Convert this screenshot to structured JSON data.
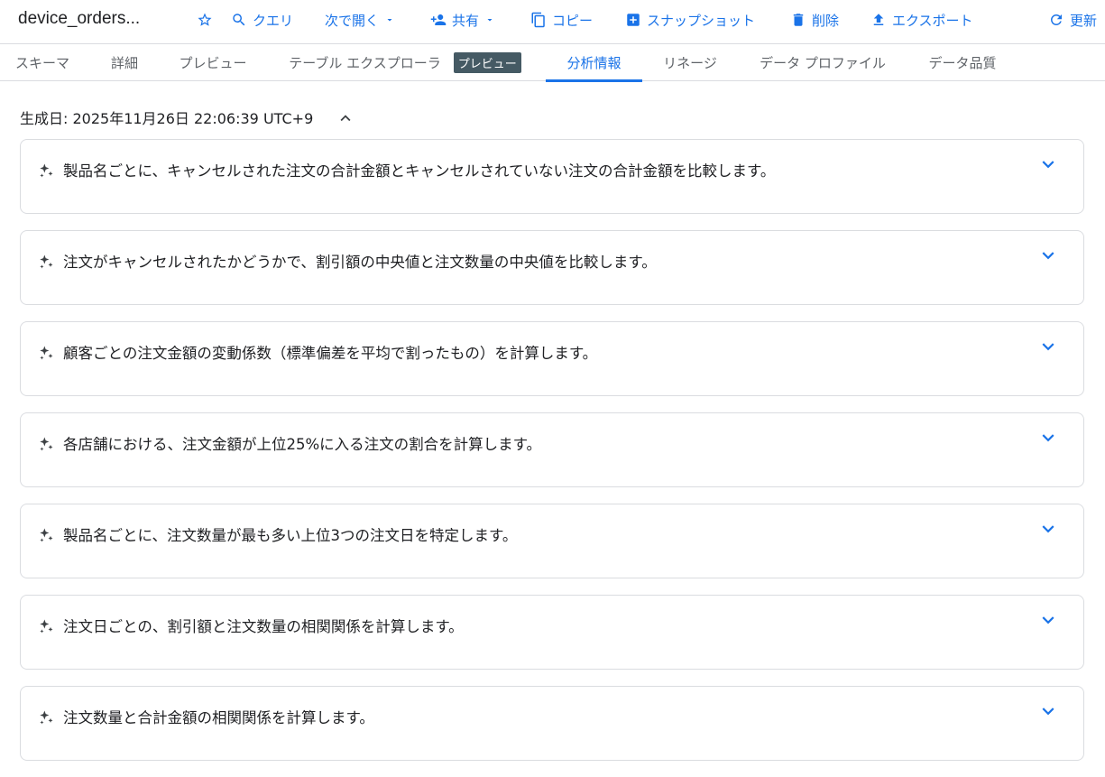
{
  "header": {
    "title": "device_orders...",
    "buttons": {
      "query": "クエリ",
      "open_with": "次で開く",
      "share": "共有",
      "copy": "コピー",
      "snapshot": "スナップショット",
      "delete": "削除",
      "export": "エクスポート",
      "refresh": "更新"
    }
  },
  "tabs": [
    {
      "label": "スキーマ"
    },
    {
      "label": "詳細"
    },
    {
      "label": "プレビュー"
    },
    {
      "label": "テーブル エクスプローラ",
      "badge": "プレビュー"
    },
    {
      "label": "分析情報",
      "active": true
    },
    {
      "label": "リネージ"
    },
    {
      "label": "データ プロファイル"
    },
    {
      "label": "データ品質"
    }
  ],
  "insights": {
    "generated": "生成日: 2025年11月26日 22:06:39 UTC+9",
    "items": [
      "製品名ごとに、キャンセルされた注文の合計金額とキャンセルされていない注文の合計金額を比較します。",
      "注文がキャンセルされたかどうかで、割引額の中央値と注文数量の中央値を比較します。",
      "顧客ごとの注文金額の変動係数（標準偏差を平均で割ったもの）を計算します。",
      "各店舗における、注文金額が上位25%に入る注文の割合を計算します。",
      "製品名ごとに、注文数量が最も多い上位3つの注文日を特定します。",
      "注文日ごとの、割引額と注文数量の相関関係を計算します。",
      "注文数量と合計金額の相関関係を計算します。"
    ]
  },
  "colors": {
    "accent": "#1a73e8",
    "badge": "#455a64",
    "border": "#dadce0"
  }
}
